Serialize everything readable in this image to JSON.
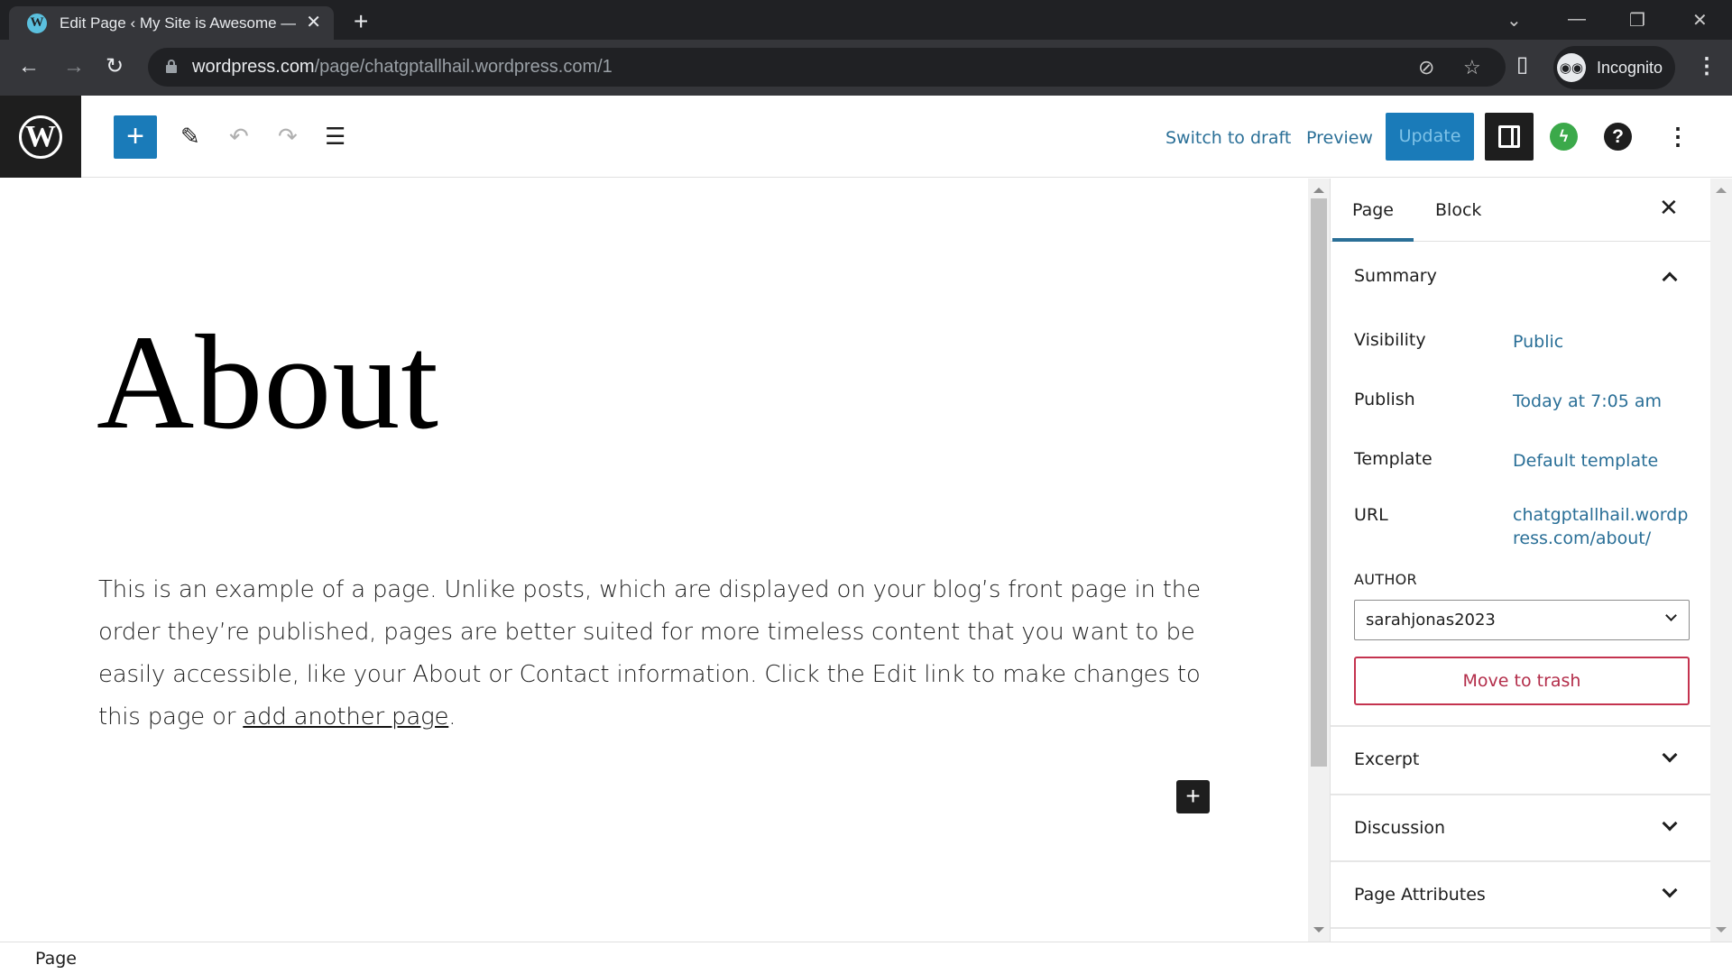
{
  "browser": {
    "tab_title": "Edit Page ‹ My Site is Awesome —",
    "tab_favicon": "wordpress-icon",
    "new_tab_label": "+",
    "url_host": "wordpress.com",
    "url_path": "/page/chatgptallhail.wordpress.com/1",
    "profile_label": "Incognito",
    "icons": {
      "back": "←",
      "forward": "→",
      "reload": "↻",
      "tracking_off": "⊘",
      "bookmark": "☆",
      "side_panel": "▯",
      "menu": "⋮",
      "tab_search": "⌄",
      "minimize": "—",
      "restore": "❐",
      "close": "✕",
      "tab_close": "✕",
      "incognito": "🕶"
    }
  },
  "editor_header": {
    "logo_glyph": "W",
    "inserter_glyph": "+",
    "tools_glyph": "✎",
    "undo_glyph": "↶",
    "redo_glyph": "↷",
    "list_view_glyph": "☰",
    "switch_to_draft": "Switch to draft",
    "preview": "Preview",
    "update": "Update",
    "jetpack_glyph": "ϟ",
    "help_glyph": "?",
    "options_glyph": "⋮"
  },
  "canvas": {
    "title": "About",
    "body_text": "This is an example of a page. Unlike posts, which are displayed on your blog’s front page in the order they’re published, pages are better suited for more timeless content that you want to be easily accessible, like your About or Contact information. Click the Edit link to make changes to this page or ",
    "body_link": "add another page",
    "body_end": ".",
    "block_inserter_glyph": "+"
  },
  "sidebar": {
    "tabs": [
      {
        "label": "Page",
        "active": true
      },
      {
        "label": "Block",
        "active": false
      }
    ],
    "close_glyph": "✕",
    "summary": {
      "title": "Summary",
      "expanded": true,
      "rows": [
        {
          "label": "Visibility",
          "value": "Public"
        },
        {
          "label": "Publish",
          "value": "Today at 7:05 am"
        },
        {
          "label": "Template",
          "value": "Default template"
        },
        {
          "label": "URL",
          "value": "chatgptallhail.wordpress.com/about/"
        }
      ],
      "author_label": "AUTHOR",
      "author_value": "sarahjonas2023",
      "trash_label": "Move to trash"
    },
    "panels": [
      {
        "title": "Excerpt",
        "expanded": false
      },
      {
        "title": "Discussion",
        "expanded": false
      },
      {
        "title": "Page Attributes",
        "expanded": false
      }
    ]
  },
  "footer": {
    "breadcrumb": "Page"
  },
  "colors": {
    "accent": "#1a7bb9",
    "link": "#2a6f97",
    "danger": "#c4334f",
    "dark": "#1e1e1e"
  }
}
